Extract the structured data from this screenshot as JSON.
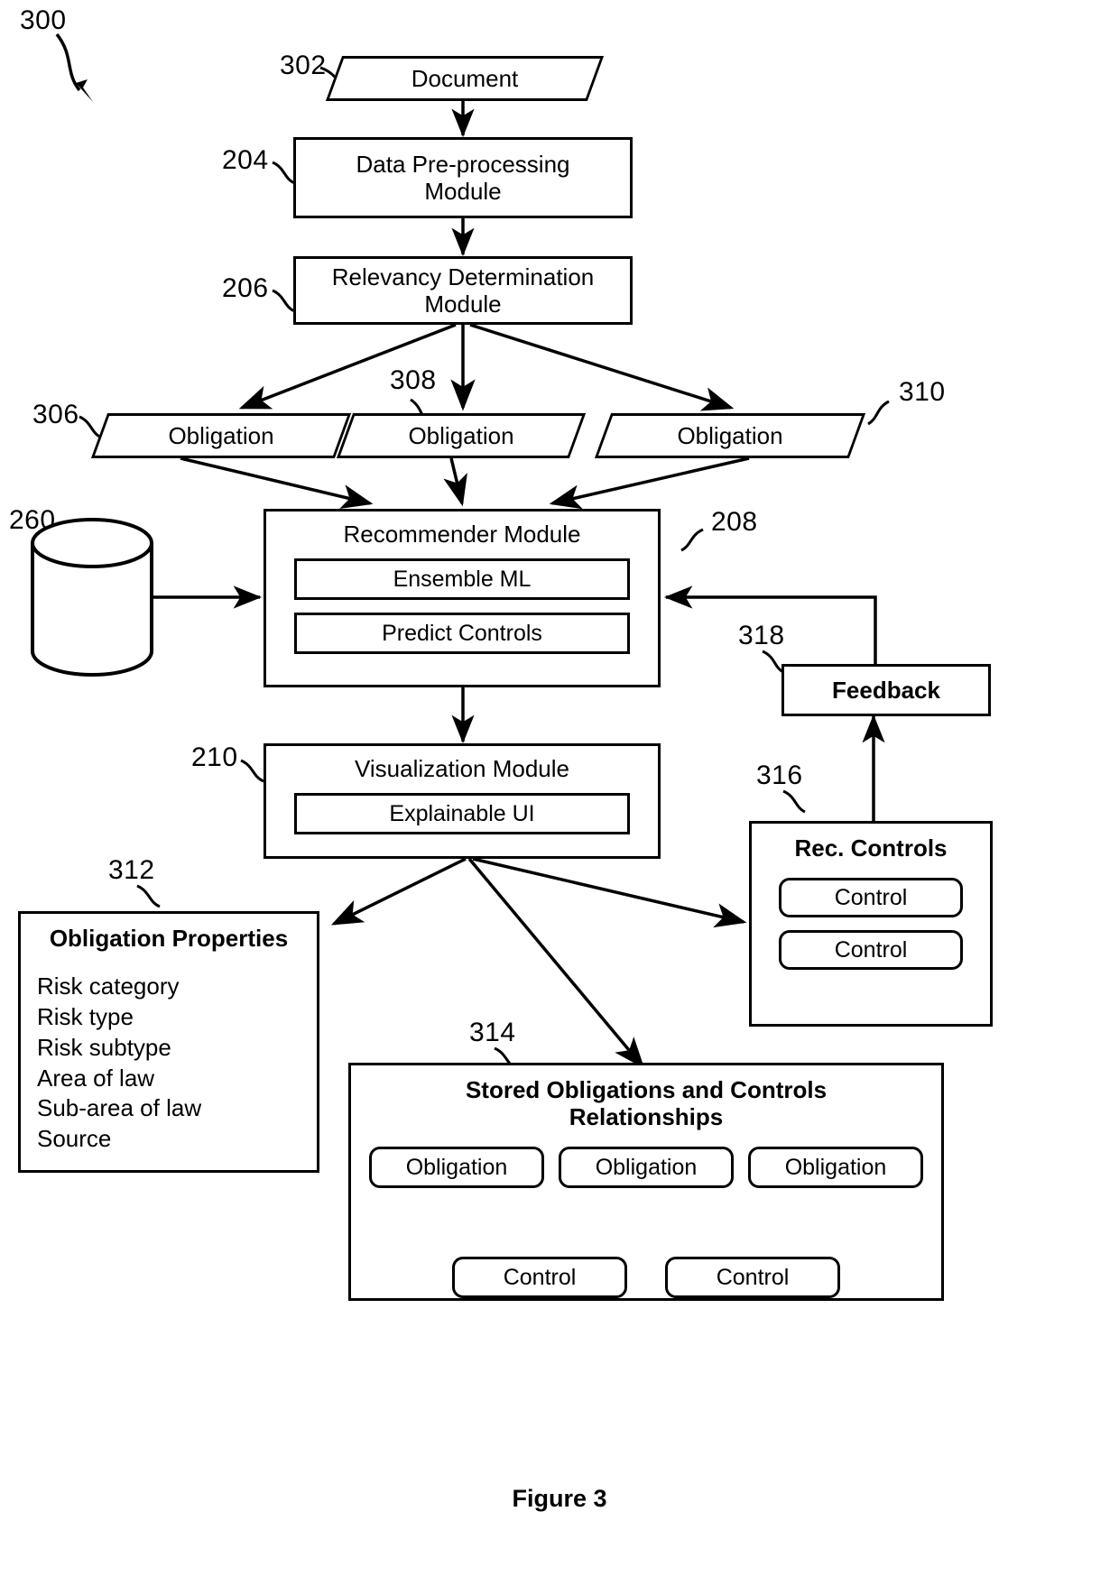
{
  "figure": {
    "number": "300",
    "caption": "Figure 3"
  },
  "nodes": {
    "document": {
      "ref": "302",
      "label": "Document"
    },
    "preprocessing": {
      "ref": "204",
      "label": "Data Pre-processing\nModule"
    },
    "relevancy": {
      "ref": "206",
      "label": "Relevancy Determination\nModule"
    },
    "obligation_a": {
      "ref": "306",
      "label": "Obligation"
    },
    "obligation_b": {
      "ref": "308",
      "label": "Obligation"
    },
    "obligation_c": {
      "ref": "310",
      "label": "Obligation"
    },
    "database": {
      "ref": "260",
      "label": ""
    },
    "recommender": {
      "ref": "208",
      "label": "Recommender Module",
      "items": [
        "Ensemble ML",
        "Predict Controls"
      ]
    },
    "visualization": {
      "ref": "210",
      "label": "Visualization Module",
      "items": [
        "Explainable UI"
      ]
    },
    "feedback": {
      "ref": "318",
      "label": "Feedback"
    },
    "rec_controls": {
      "ref": "316",
      "label": "Rec. Controls",
      "items": [
        "Control",
        "Control"
      ]
    },
    "obligation_properties": {
      "ref": "312",
      "label": "Obligation Properties",
      "properties": [
        "Risk category",
        "Risk type",
        "Risk subtype",
        "Area of law",
        "Sub-area of law",
        "Source"
      ]
    },
    "stored_relationships": {
      "ref": "314",
      "label": "Stored Obligations and Controls\nRelationships",
      "obligations": [
        "Obligation",
        "Obligation",
        "Obligation"
      ],
      "controls": [
        "Control",
        "Control"
      ]
    }
  },
  "style": {
    "stroke": "#000000",
    "background": "#ffffff"
  }
}
